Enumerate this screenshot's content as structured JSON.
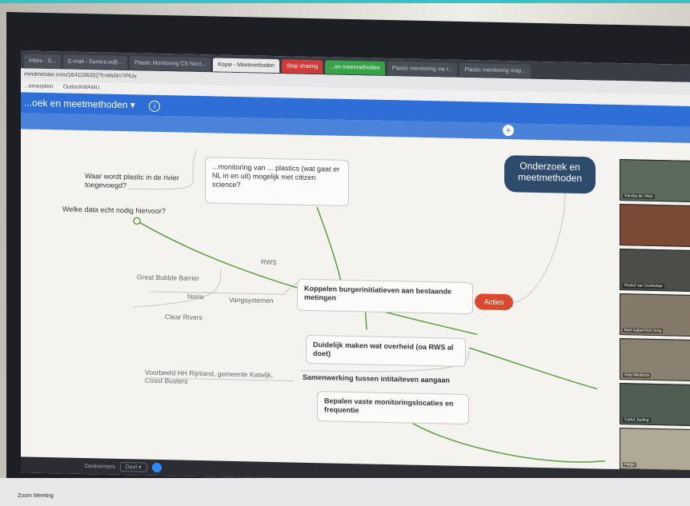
{
  "browser": {
    "tabs": [
      "Inbox - S...",
      "E-mail - Samira.w@...",
      "Plastic Monitoring CS Next...",
      "Kopie - Meetmethoden",
      "Stop sharing",
      "...en meetmethoden",
      "Plastic monitoring via r...",
      "Plastic monitoring map..."
    ],
    "url": "mindmeister.com/1641196202?t=MsNV7PlUx",
    "bookmarks": [
      "...emerplein",
      "OutlookWAMU"
    ]
  },
  "app": {
    "title": "...oek en meetmethoden ▾",
    "info_icon": "i"
  },
  "mindmap": {
    "hub": "Onderzoek en meetmethoden",
    "acties": "Acties",
    "top_left_1": "Waar wordt plastic in de rivier toegevoegd?",
    "top_left_2": "Welke data echt nodig hiervoor?",
    "top_center": "...monitoring van ... plastics (wat gaat er NL in en uit) mogelijk met citizen science?",
    "rws": "RWS",
    "koppelen": "Koppelen burgerinitiatieven aan bestaande metingen",
    "vangsystemen": "Vangsystemen",
    "great_bubble": "Great Bubble Barrier",
    "noria": "Noria",
    "clear_rivers": "Clear Rivers",
    "duidelijk": "Duidelijk maken wat overheid (oa RWS al doet)",
    "voorbeeld": "Voorbeeld HH Rijnland, gemeente Katwijk, Coast Busters",
    "samenwerking": "Samenwerking tussen intitaiteven aangaan",
    "bepalen": "Bepalen vaste monitoringslocaties en frequentie"
  },
  "participants": [
    "Sandra de Vries",
    "",
    "Roelof van Donkelaar",
    "Bart Isabel Roil Jong",
    "Anja Medema",
    "Carlot Jeeling",
    "Helge"
  ],
  "taskbar": {
    "zoom": "Deelnemers",
    "share": "Deel ▾"
  },
  "zoom_window": "Zoom Meeting"
}
